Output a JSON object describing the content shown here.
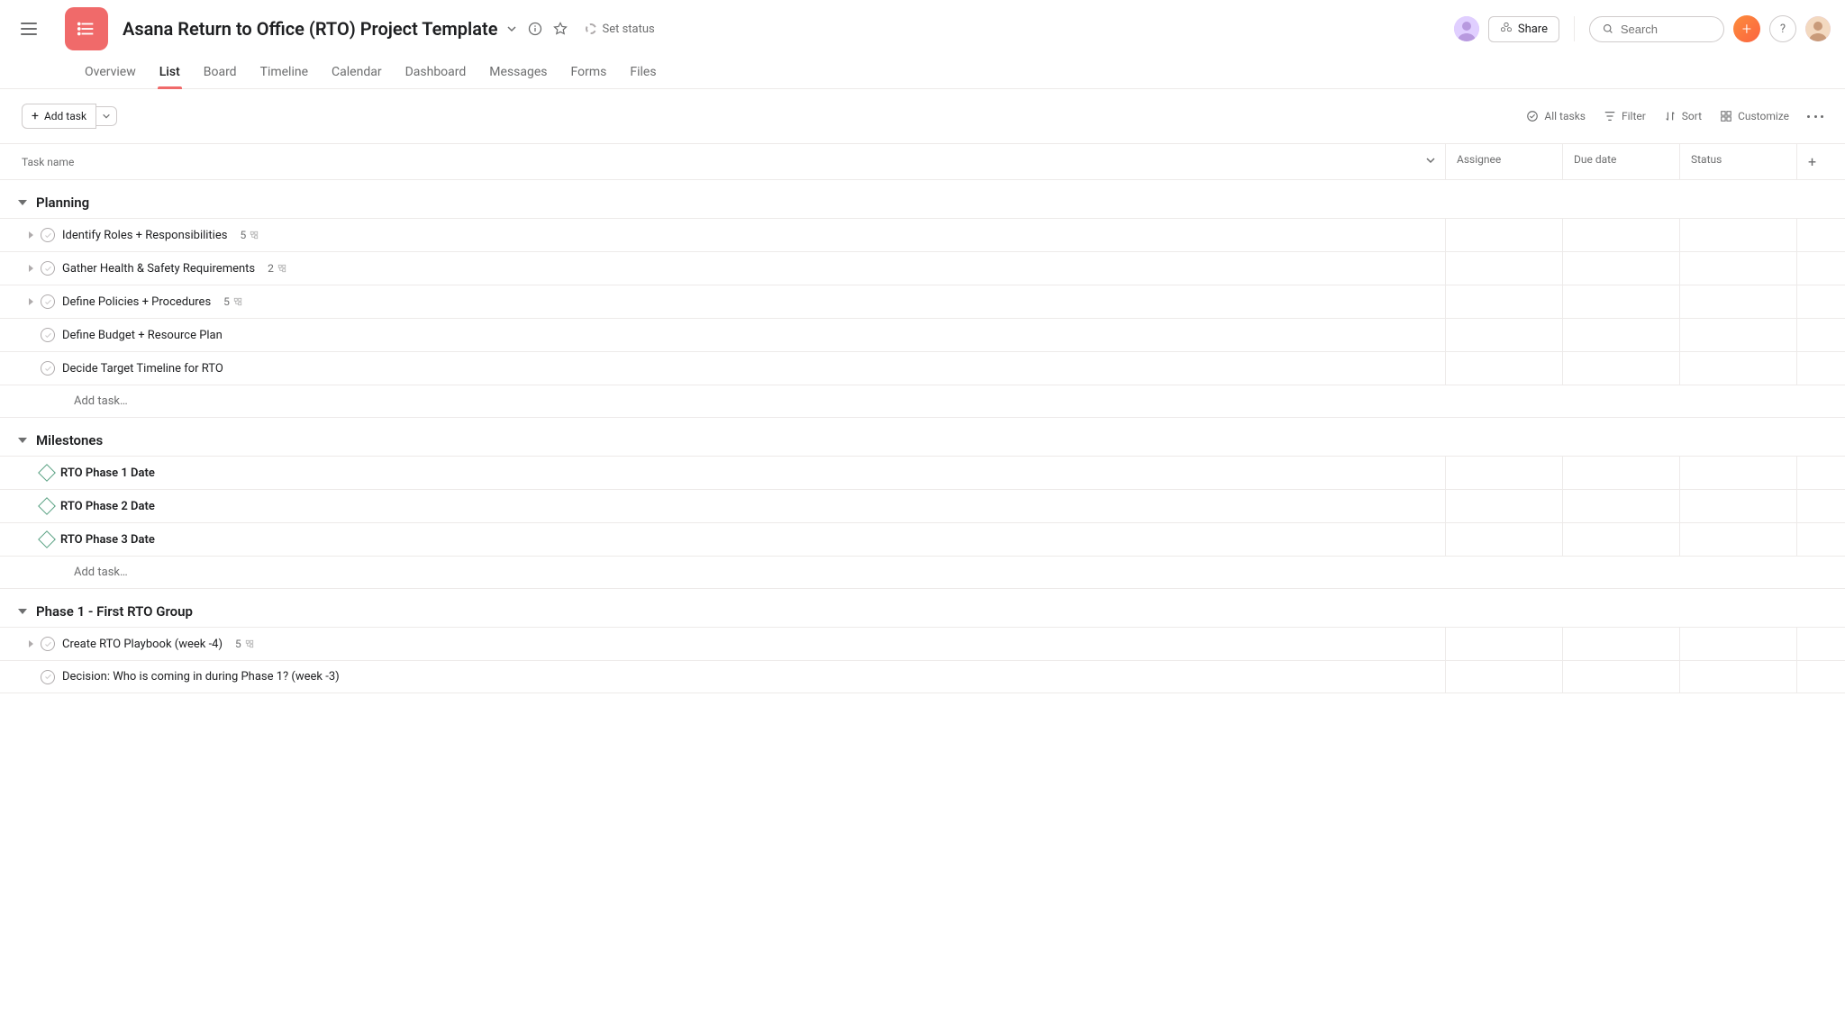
{
  "header": {
    "title": "Asana Return to Office (RTO) Project Template",
    "set_status": "Set status",
    "share": "Share",
    "search_placeholder": "Search",
    "help": "?"
  },
  "tabs": [
    "Overview",
    "List",
    "Board",
    "Timeline",
    "Calendar",
    "Dashboard",
    "Messages",
    "Forms",
    "Files"
  ],
  "toolbar": {
    "add_task": "Add task",
    "all_tasks": "All tasks",
    "filter": "Filter",
    "sort": "Sort",
    "customize": "Customize"
  },
  "columns": {
    "task_name": "Task name",
    "assignee": "Assignee",
    "due_date": "Due date",
    "status": "Status"
  },
  "sections": [
    {
      "title": "Planning",
      "tasks": [
        {
          "name": "Identify Roles + Responsibilities",
          "subtasks": "5",
          "expandable": true,
          "type": "task"
        },
        {
          "name": "Gather Health & Safety Requirements",
          "subtasks": "2",
          "expandable": true,
          "type": "task"
        },
        {
          "name": "Define Policies + Procedures",
          "subtasks": "5",
          "expandable": true,
          "type": "task"
        },
        {
          "name": "Define Budget + Resource Plan",
          "subtasks": "",
          "expandable": false,
          "type": "task"
        },
        {
          "name": "Decide Target Timeline for RTO",
          "subtasks": "",
          "expandable": false,
          "type": "task"
        }
      ],
      "add_label": "Add task…"
    },
    {
      "title": "Milestones",
      "tasks": [
        {
          "name": "RTO Phase 1 Date",
          "subtasks": "",
          "expandable": false,
          "type": "milestone"
        },
        {
          "name": "RTO Phase 2 Date",
          "subtasks": "",
          "expandable": false,
          "type": "milestone"
        },
        {
          "name": "RTO Phase 3 Date",
          "subtasks": "",
          "expandable": false,
          "type": "milestone"
        }
      ],
      "add_label": "Add task…"
    },
    {
      "title": "Phase 1 - First RTO Group",
      "tasks": [
        {
          "name": "Create RTO Playbook (week -4)",
          "subtasks": "5",
          "expandable": true,
          "type": "task"
        },
        {
          "name": "Decision: Who is coming in during Phase 1? (week -3)",
          "subtasks": "",
          "expandable": false,
          "type": "task"
        }
      ],
      "add_label": ""
    }
  ]
}
